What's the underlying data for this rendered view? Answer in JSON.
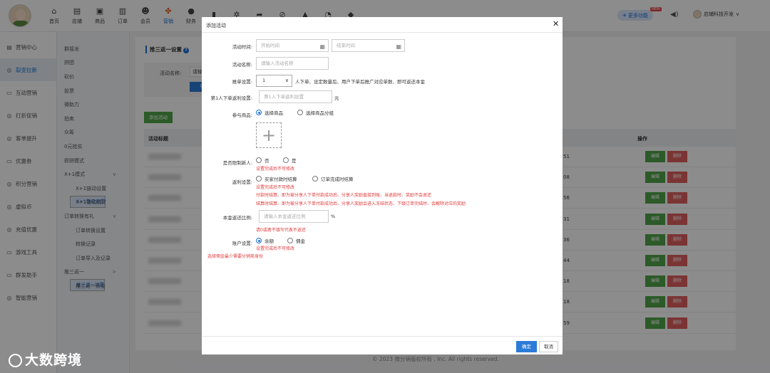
{
  "nav": [
    {
      "label": "首页",
      "icon": "home-icon",
      "glyph": "⌂"
    },
    {
      "label": "店铺",
      "icon": "store-icon",
      "glyph": "▤"
    },
    {
      "label": "商品",
      "icon": "goods-icon",
      "glyph": "▣"
    },
    {
      "label": "订单",
      "icon": "order-icon",
      "glyph": "▥"
    },
    {
      "label": "会员",
      "icon": "member-icon",
      "glyph": "☻"
    },
    {
      "label": "营销",
      "icon": "marketing-icon",
      "glyph": "✤",
      "active": true
    },
    {
      "label": "财务",
      "icon": "finance-icon",
      "glyph": "●"
    },
    {
      "label": "",
      "icon": "chart-icon",
      "glyph": "▮"
    },
    {
      "label": "",
      "icon": "settings-icon",
      "glyph": "✲"
    },
    {
      "label": "",
      "icon": "share-icon",
      "glyph": "➦"
    },
    {
      "label": "",
      "icon": "link-icon",
      "glyph": "⊘"
    },
    {
      "label": "",
      "icon": "graduation-icon",
      "glyph": "▲"
    },
    {
      "label": "",
      "icon": "pie-icon",
      "glyph": "◔"
    },
    {
      "label": "",
      "icon": "gift-icon",
      "glyph": "◆"
    }
  ],
  "header": {
    "more_label": "更多功能",
    "new_badge": "NEW",
    "user_name": "启辅科技开发"
  },
  "sidebar": [
    {
      "label": "营销中心",
      "glyph": "▤"
    },
    {
      "label": "裂变拉新",
      "glyph": "◎",
      "active": true
    },
    {
      "label": "互动营销",
      "glyph": "▭"
    },
    {
      "label": "打折促销",
      "glyph": "◎"
    },
    {
      "label": "客单提升",
      "glyph": "◎"
    },
    {
      "label": "优惠券",
      "glyph": "▭"
    },
    {
      "label": "积分营销",
      "glyph": "◎"
    },
    {
      "label": "虚拟币",
      "glyph": "◎"
    },
    {
      "label": "充值优惠",
      "glyph": "◎"
    },
    {
      "label": "游戏工具",
      "glyph": "▭"
    },
    {
      "label": "群发助手",
      "glyph": "▭"
    },
    {
      "label": "智能营销",
      "glyph": "◎"
    }
  ],
  "submenu": [
    {
      "label": "群接龙"
    },
    {
      "label": "拼团"
    },
    {
      "label": "砍价"
    },
    {
      "label": "投票"
    },
    {
      "label": "微助力"
    },
    {
      "label": "拍卖"
    },
    {
      "label": "众筹"
    },
    {
      "label": "0元抢实"
    },
    {
      "label": "即拼模式"
    },
    {
      "label": "X+1模式",
      "arrow": "∨"
    },
    {
      "label": "X+1链动设置",
      "lvl2": true
    },
    {
      "label": "X+1等级设置",
      "lvl2": true,
      "sel": true
    },
    {
      "label": "X+1链动统计",
      "lvl2": true
    },
    {
      "label": "订单转换有礼",
      "arrow": "∨"
    },
    {
      "label": "订单转换设置",
      "lvl2": true
    },
    {
      "label": "转换记录",
      "lvl2": true
    },
    {
      "label": "订单导入及记录",
      "lvl2": true
    },
    {
      "label": "推三返一",
      "arrow": ">"
    },
    {
      "label": "推三返一设置",
      "lvl2": true,
      "sel": true
    },
    {
      "label": "推三返一资金",
      "lvl2": true
    }
  ],
  "page": {
    "title": "推三返一设置",
    "help": "?",
    "filter_label": "活动名称:",
    "filter_value": "请输",
    "add_button": "添加活动",
    "col_title": "活动标题",
    "col_ops": "操作",
    "rows": [
      {
        "num": "51"
      },
      {
        "num": "08"
      },
      {
        "num": "56"
      },
      {
        "num": "31"
      },
      {
        "num": "36"
      },
      {
        "num": "44"
      },
      {
        "num": "18"
      },
      {
        "num": "18"
      },
      {
        "num": "59"
      }
    ],
    "edit_label": "编辑",
    "delete_label": "删除",
    "footer": "© 2023 微分销版权所有 , Inc. All rights reserved."
  },
  "watermark": "大数跨境",
  "modal": {
    "title": "添加活动",
    "time_label": "活动时间:",
    "start_placeholder": "开始时间",
    "end_placeholder": "结束时间",
    "name_label": "活动名称:",
    "name_placeholder": "请输入活动名称",
    "push_label": "推单设置:",
    "push_value": "1",
    "push_hint": "人下单、设定数量后、用户下单后推广对应单数、即可返还本金",
    "rebate_label": "第1人下单返利设置:",
    "rebate_placeholder": "第1人下单返利设置",
    "rebate_unit": "元",
    "goods_label": "参与商品:",
    "goods_opt1": "选择商品",
    "goods_opt2": "选择商品分组",
    "limit_label": "是否限制新人:",
    "limit_no": "否",
    "limit_yes": "是",
    "limit_note": "设置完成后不可修改",
    "settle_label": "返利设置:",
    "settle_opt1": "买家付款时结算",
    "settle_opt2": "订单完成时结算",
    "settle_note1": "设置完成后不可修改",
    "settle_note2": "付款时结算、即为被分享人下单付款成功后、分享人奖励直接到账、当退款时、奖励不会退还",
    "settle_note3": "结算时结算、即为被分享人下单付款成功后、分享人奖励会进入冻结状态、下级订单完结时、会解除对应的奖励",
    "ratio_label": "本金返还比例:",
    "ratio_placeholder": "请输入本金返还比例",
    "ratio_unit": "%",
    "ratio_note": "请0或者不填写代表不返还",
    "account_label": "账户设置:",
    "account_opt1": "余额",
    "account_opt2": "佣金",
    "account_note": "设置完成后不可修改",
    "account_note2": "选择佣金最少需要分销商身份",
    "ok": "确定",
    "cancel": "取消"
  }
}
